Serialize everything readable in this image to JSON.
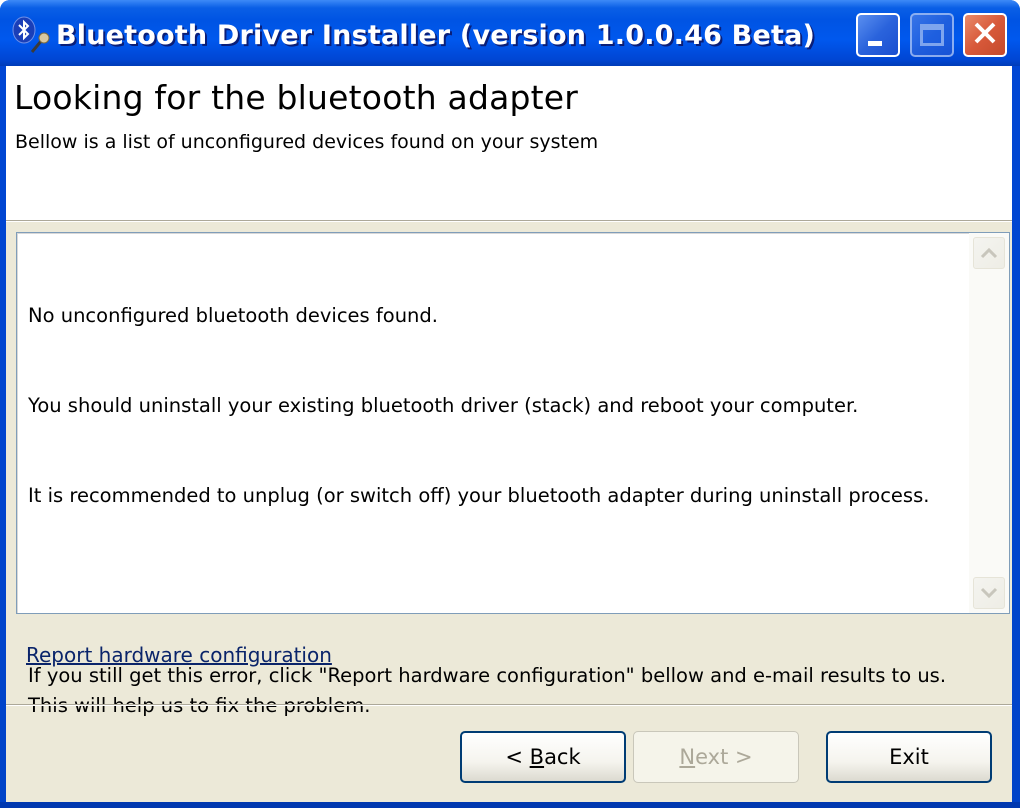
{
  "window": {
    "title": "Bluetooth Driver Installer (version 1.0.0.46 Beta)",
    "app_icon": "bluetooth-key-icon",
    "controls": {
      "minimize": "minimize-icon",
      "maximize": "maximize-icon",
      "close": "close-icon"
    }
  },
  "header": {
    "title": "Looking for the bluetooth adapter",
    "subtitle": "Bellow is a list of unconfigured devices found on your system"
  },
  "message_box": {
    "lines": [
      "No unconfigured bluetooth devices found.",
      "You should uninstall your existing bluetooth driver (stack) and reboot your computer.",
      "It is recommended to unplug (or switch off) your bluetooth adapter during uninstall process.",
      "",
      "If you still get this error, click \"Report hardware configuration\" bellow and e-mail results to us. This will help us to fix the problem."
    ],
    "scroll_up_icon": "chevron-up-icon",
    "scroll_down_icon": "chevron-down-icon"
  },
  "link": {
    "report_label": "Report hardware configuration"
  },
  "buttons": {
    "back": {
      "prefix": "< ",
      "mnemonic": "B",
      "rest": "ack",
      "enabled": true
    },
    "next": {
      "prefix": "",
      "mnemonic": "N",
      "rest": "ext >",
      "enabled": false
    },
    "exit": {
      "label": "Exit",
      "enabled": true
    }
  }
}
